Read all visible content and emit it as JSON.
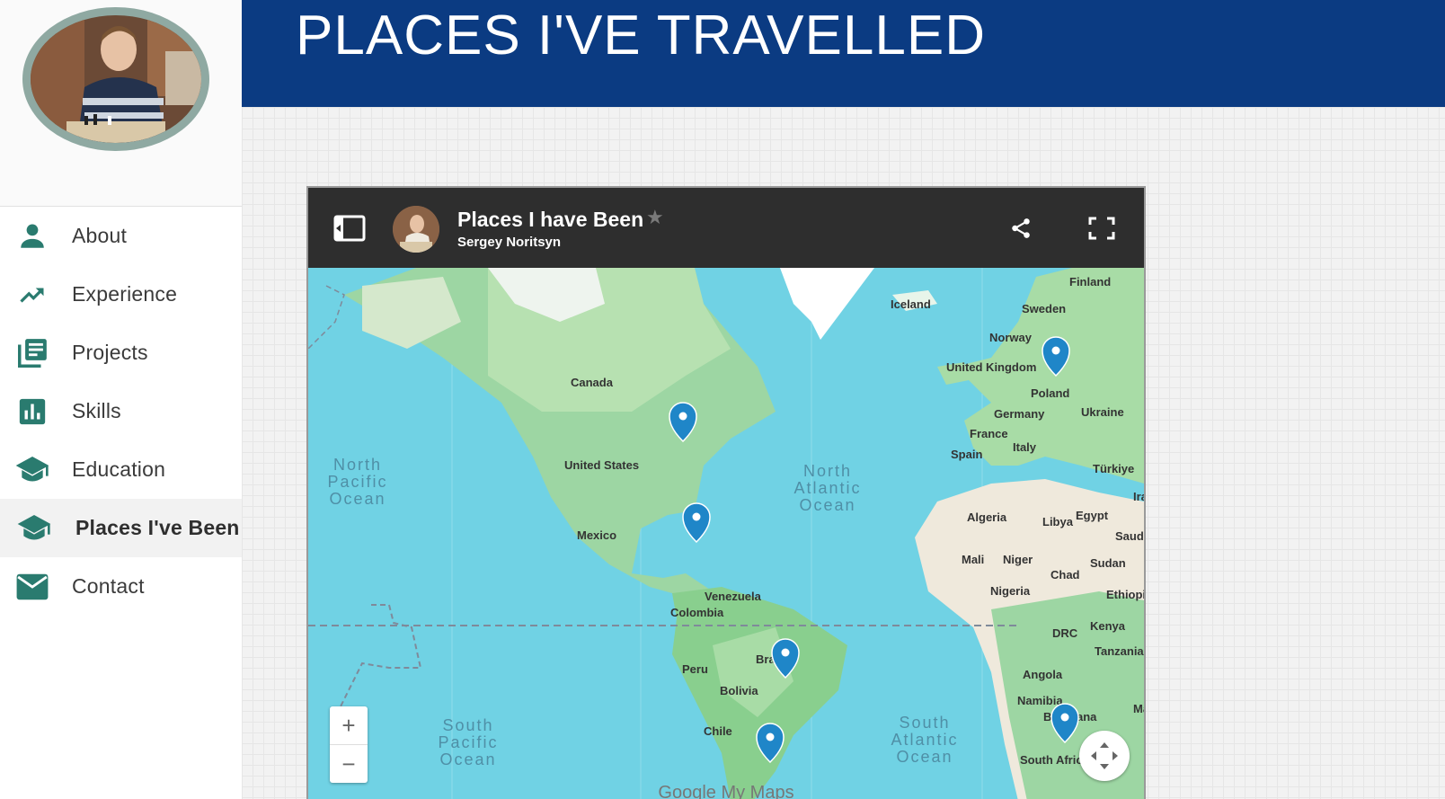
{
  "sidebar": {
    "items": [
      {
        "label": "About",
        "icon": "person-icon"
      },
      {
        "label": "Experience",
        "icon": "trending-up-icon"
      },
      {
        "label": "Projects",
        "icon": "library-books-icon"
      },
      {
        "label": "Skills",
        "icon": "bar-chart-icon"
      },
      {
        "label": "Education",
        "icon": "school-icon"
      },
      {
        "label": "Places I've Been",
        "icon": "school-icon",
        "active": true
      },
      {
        "label": "Contact",
        "icon": "email-icon"
      }
    ],
    "accent_color": "#2a7b6f"
  },
  "header": {
    "title": "PLACES I'VE TRAVELLED",
    "bg_color": "#0b3b82"
  },
  "map": {
    "title": "Places I have Been",
    "owner": "Sergey Noritsyn",
    "footer_brand": "Google My Maps",
    "zoom_in": "+",
    "zoom_out": "−",
    "labels": {
      "finland": "Finland",
      "iceland": "Iceland",
      "sweden": "Sweden",
      "norway": "Norway",
      "uk": "United Kingdom",
      "poland": "Poland",
      "canada": "Canada",
      "germany": "Germany",
      "ukraine": "Ukraine",
      "france": "France",
      "italy": "Italy",
      "spain": "Spain",
      "turkiye": "Türkiye",
      "usa": "United States",
      "north_pacific": "North Pacific Ocean",
      "north_atlantic": "North Atlantic Ocean",
      "iran": "Ira",
      "algeria": "Algeria",
      "libya": "Libya",
      "egypt": "Egypt",
      "saudi": "Saudi",
      "mexico": "Mexico",
      "mali": "Mali",
      "niger": "Niger",
      "sudan": "Sudan",
      "chad": "Chad",
      "nigeria": "Nigeria",
      "ethiopia": "Ethiopi",
      "venezuela": "Venezuela",
      "colombia": "Colombia",
      "kenya": "Kenya",
      "drc": "DRC",
      "tanzania": "Tanzania",
      "peru": "Peru",
      "brazil": "Bra",
      "angola": "Angola",
      "bolivia": "Bolivia",
      "namibia": "Namibia",
      "madagascar": "Ma",
      "botswana": "B",
      "botswana_tail": "ana",
      "chile": "Chile",
      "south_pacific": "South Pacific Ocean",
      "south_atlantic": "South Atlantic Ocean",
      "south_africa": "South Afric"
    },
    "pins": [
      "Poland",
      "Great Lakes",
      "Florida / Caribbean",
      "Brazil",
      "Argentina",
      "Southern Africa"
    ]
  }
}
